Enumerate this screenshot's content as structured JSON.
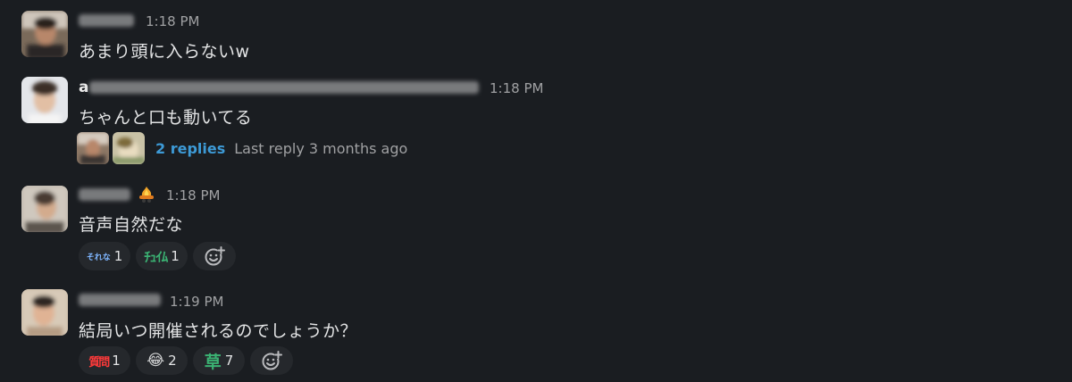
{
  "messages": [
    {
      "time": "1:18 PM",
      "text": "あまり頭に入らないw"
    },
    {
      "name_prefix": "a",
      "time": "1:18 PM",
      "text": "ちゃんと口も動いてる",
      "thread": {
        "replies": "2 replies",
        "last_reply": "Last reply 3 months ago"
      }
    },
    {
      "time": "1:18 PM",
      "text": "音声自然だな",
      "reactions": [
        {
          "emoji": "それな",
          "count": "1"
        },
        {
          "emoji": "ﾁｭｲﾑ",
          "count": "1"
        }
      ]
    },
    {
      "time": "1:19 PM",
      "text": "結局いつ開催されるのでしょうか？",
      "reactions": [
        {
          "emoji": "質問",
          "count": "1"
        },
        {
          "emoji": "😂",
          "count": "2"
        },
        {
          "emoji": "草",
          "count": "7"
        }
      ]
    }
  ],
  "colors": {
    "background": "#1a1d21",
    "link": "#3d9ad6",
    "reaction_bg": "#25282c",
    "muted": "#a0a1a3"
  },
  "icons": {
    "add_reaction": "add-reaction-icon",
    "status": "fire-hat-status-icon"
  }
}
